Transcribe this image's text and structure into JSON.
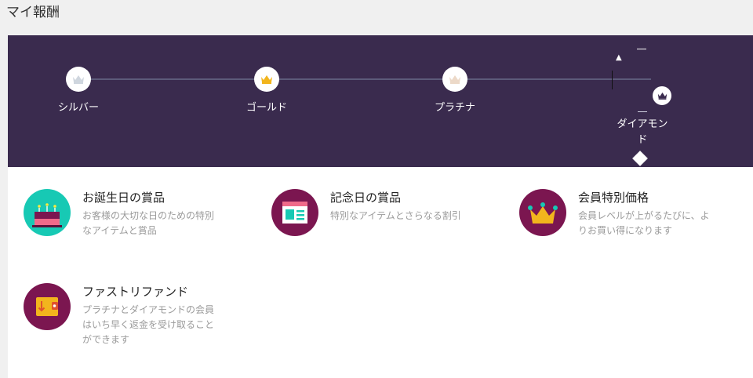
{
  "page": {
    "title": "マイ報酬"
  },
  "tiers": [
    {
      "label": "シルバー",
      "icon": "silver-crown-icon",
      "color": "#cfd6de"
    },
    {
      "label": "ゴールド",
      "icon": "gold-crown-icon",
      "color": "#f2b51d"
    },
    {
      "label": "プラチナ",
      "icon": "platinum-crown-icon",
      "color": "#ecd9c8"
    },
    {
      "label": "ダイアモンド",
      "icon": "diamond-crown-icon",
      "color": "#3a2b4e",
      "current": true
    }
  ],
  "benefits": [
    {
      "title": "お誕生日の賞品",
      "desc": "お客様の大切な日のための特別なアイテムと賞品",
      "icon": "birthday-cake-icon",
      "bg": "#17c9b4"
    },
    {
      "title": "記念日の賞品",
      "desc": "特別なアイテムとさらなる割引",
      "icon": "anniversary-card-icon",
      "bg": "#7b1650"
    },
    {
      "title": "会員特別価格",
      "desc": "会員レベルが上がるたびに、よりお買い得になります",
      "icon": "member-crown-icon",
      "bg": "#7b1650"
    },
    {
      "title": "ファストリファンド",
      "desc": "プラチナとダイアモンドの会員はいち早く返金を受け取ることができます",
      "icon": "refund-wallet-icon",
      "bg": "#7b1650"
    }
  ],
  "colors": {
    "panel": "#3a2b4e",
    "accent_magenta": "#7b1650",
    "accent_teal": "#17c9b4",
    "gold": "#f2b51d"
  }
}
